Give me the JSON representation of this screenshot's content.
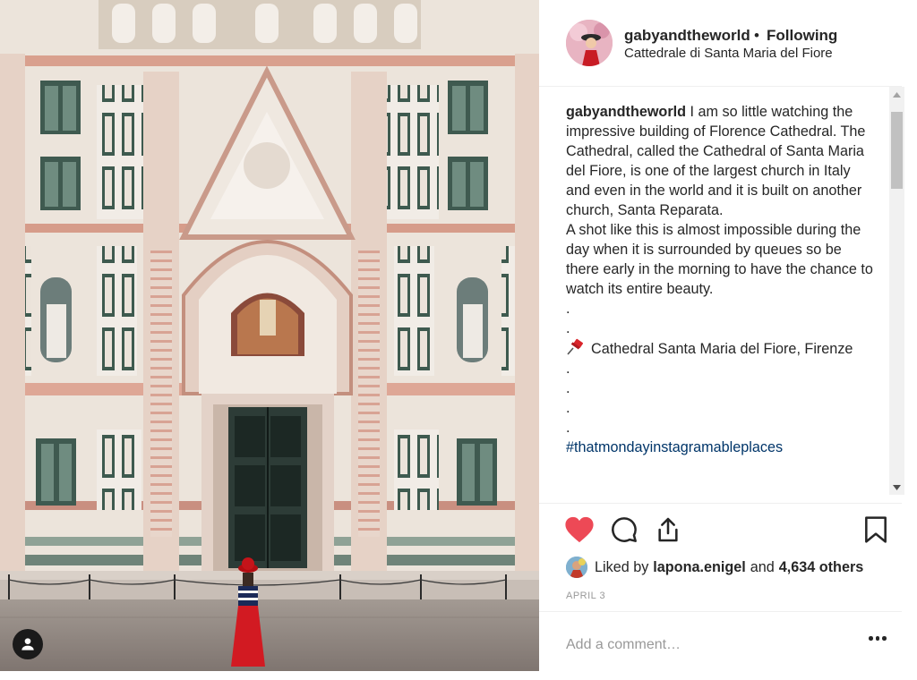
{
  "post": {
    "username": "gabyandtheworld",
    "follow_status": "Following",
    "separator": "•",
    "location": "Cattedrale di Santa Maria del Fiore"
  },
  "caption": {
    "username": "gabyandtheworld",
    "paragraph1": "I am so little watching the impressive building of Florence Cathedral. The Cathedral, called the Cathedral of Santa Maria del Fiore, is one of the largest church in Italy and even in the world and it is built on another church, Santa Reparata.",
    "paragraph2": "A shot like this is almost impossible during the day when it is surrounded by queues so be there early in the morning to have the chance to watch its entire beauty.",
    "dot1": ".",
    "dot2": ".",
    "location_line": "Cathedral Santa Maria del Fiore, Firenze",
    "dot3": ".",
    "dot4": ".",
    "dot5": ".",
    "dot6": ".",
    "hashtag": "#thatmondayinstagramableplaces"
  },
  "likes": {
    "prefix": "Liked by",
    "liked_by_user": "lapona.enigel",
    "conjunction": "and",
    "others": "4,634 others"
  },
  "date": "APRIL 3",
  "comment": {
    "placeholder": "Add a comment…"
  },
  "icons": {
    "like": "heart-icon",
    "comment": "speech-bubble-icon",
    "share": "share-icon",
    "save": "bookmark-icon",
    "user_tag": "user-icon",
    "more": "ellipsis-icon",
    "pin": "pushpin-icon"
  },
  "colors": {
    "like_active": "#ed4956",
    "hashtag": "#003569",
    "text": "#262626",
    "muted": "#999999"
  }
}
